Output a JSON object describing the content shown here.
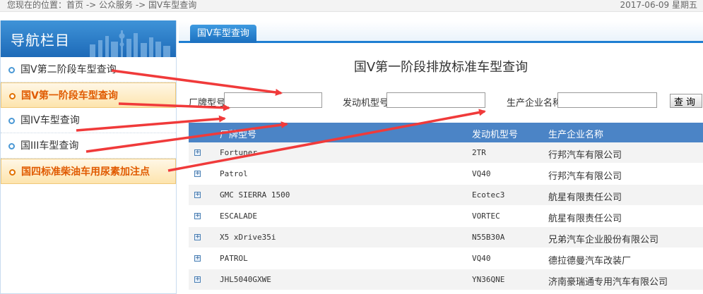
{
  "breadcrumb": {
    "text": "您现在的位置：首页 -> 公众服务 -> 国V车型查询"
  },
  "date": {
    "text": "2017-06-09 星期五"
  },
  "sidebar": {
    "title": "导航栏目",
    "items": [
      {
        "label": "国V第二阶段车型查询"
      },
      {
        "label": "国V第一阶段车型查询"
      },
      {
        "label": "国IV车型查询"
      },
      {
        "label": "国III车型查询"
      },
      {
        "label": "国四标准柴油车用尿素加注点"
      }
    ]
  },
  "main": {
    "tab_label": "国V车型查询",
    "heading": "国V第一阶段排放标准车型查询",
    "form": {
      "vehicle_model_label": "厂牌型号",
      "engine_model_label": "发动机型号",
      "manufacturer_label": "生产企业名称",
      "search_button": "查询"
    },
    "table": {
      "columns": {
        "model": "厂牌型号",
        "engine": "发动机型号",
        "manufacturer": "生产企业名称"
      },
      "rows": [
        {
          "model": "Fortuner",
          "engine": "2TR",
          "manufacturer": "行邦汽车有限公司"
        },
        {
          "model": "Patrol",
          "engine": "VQ40",
          "manufacturer": "行邦汽车有限公司"
        },
        {
          "model": "GMC SIERRA 1500",
          "engine": "Ecotec3",
          "manufacturer": "航星有限责任公司"
        },
        {
          "model": "ESCALADE",
          "engine": "VORTEC",
          "manufacturer": "航星有限责任公司"
        },
        {
          "model": "X5 xDrive35i",
          "engine": "N55B30A",
          "manufacturer": "兄弟汽车企业股份有限公司"
        },
        {
          "model": "PATROL",
          "engine": "VQ40",
          "manufacturer": "德拉德曼汽车改装厂"
        },
        {
          "model": "JHL5040GXWE",
          "engine": "YN36QNE",
          "manufacturer": "济南豪瑞通专用汽车有限公司"
        }
      ]
    }
  },
  "colors": {
    "accent": "#1e7ed2",
    "header_row": "#4b84c6",
    "active_item": "#e05a00",
    "annotation_arrow": "#f03a3a"
  }
}
